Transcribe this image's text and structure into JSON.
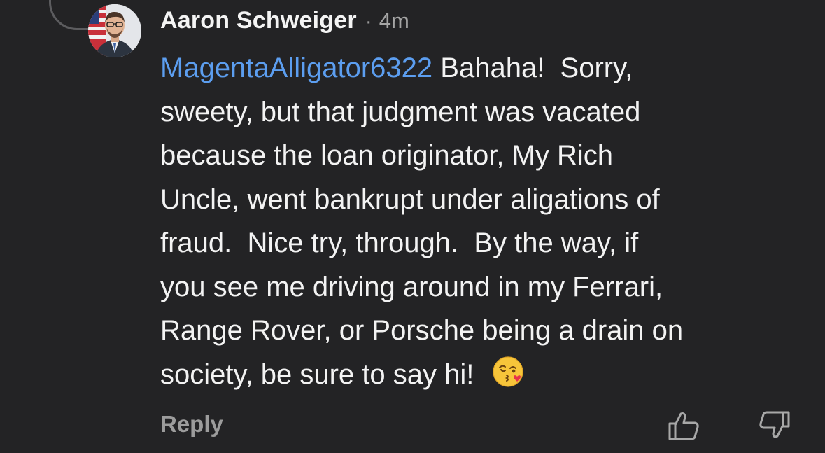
{
  "comment": {
    "author": "Aaron Schweiger",
    "separator": "·",
    "time": "4m",
    "mention": "MagentaAlligator6322",
    "text_line1": " Bahaha!  Sorry,\n",
    "text_rest": "sweety, but that judgment was vacated\nbecause the loan originator, My Rich\nUncle, went bankrupt under aligations of\nfraud.  Nice try, through.  By the way, if\nyou see me driving around in my Ferrari,\nRange Rover, or Porsche being a drain on\nsociety, be sure to say hi!",
    "emoji": "kissing-face-with-heart-emoji"
  },
  "actions": {
    "reply_label": "Reply",
    "upvote_icon": "thumbs-up-icon",
    "downvote_icon": "thumbs-down-icon"
  },
  "colors": {
    "background": "#232325",
    "mention": "#5c9ef0",
    "muted": "#9c9c9c"
  }
}
